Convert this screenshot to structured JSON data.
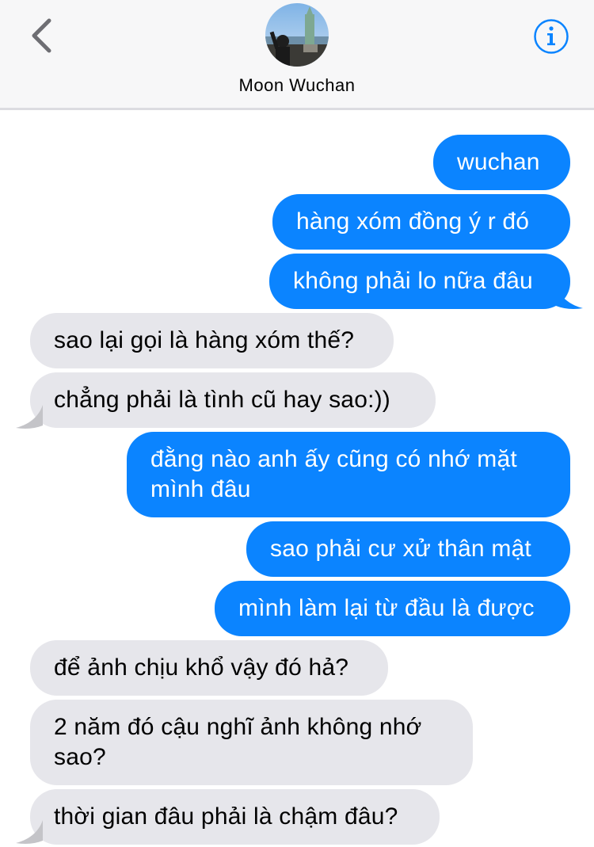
{
  "header": {
    "contact_name": "Moon Wuchan",
    "back_icon": "chevron-left-icon",
    "info_icon": "info-icon",
    "accent_color": "#0b84ff"
  },
  "messages": [
    {
      "direction": "outgoing",
      "text": "wuchan"
    },
    {
      "direction": "outgoing",
      "text": "hàng xóm đồng ý r đó"
    },
    {
      "direction": "outgoing",
      "text": "không phải lo nữa đâu"
    },
    {
      "direction": "incoming",
      "text": "sao lại gọi là hàng xóm thế?"
    },
    {
      "direction": "incoming",
      "text": "chẳng phải là tình cũ hay sao:))"
    },
    {
      "direction": "outgoing",
      "text_line1": "đằng nào anh ấy cũng có nhớ mặt",
      "text_line2": "mình đâu"
    },
    {
      "direction": "outgoing",
      "text": "sao phải cư xử thân mật"
    },
    {
      "direction": "outgoing",
      "text": "mình làm lại từ đầu là được"
    },
    {
      "direction": "incoming",
      "text": "để ảnh chịu khổ vậy đó hả?"
    },
    {
      "direction": "incoming",
      "text_line1": "2 năm đó cậu nghĩ ảnh không nhớ",
      "text_line2": "sao?"
    },
    {
      "direction": "incoming",
      "text": "thời gian đâu phải là chậm đâu?"
    }
  ],
  "colors": {
    "outgoing_bubble": "#0b84ff",
    "incoming_bubble": "#e6e6eb",
    "header_background": "#f7f7f8"
  }
}
